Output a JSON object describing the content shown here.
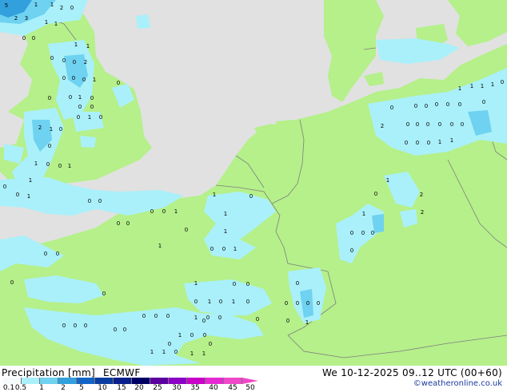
{
  "map": {
    "colors": {
      "sea": "#e1e1e1",
      "land": "#b5f08a",
      "border": "#7f7f7f",
      "precip_light": "#aaf0fa",
      "precip_medium": "#6ed2f0",
      "precip_heavy": "#32a0dc"
    },
    "values": [
      {
        "t": "5"
      },
      {
        "t": "2"
      },
      {
        "t": "3"
      },
      {
        "t": "1"
      },
      {
        "t": "1"
      },
      {
        "t": "1"
      },
      {
        "t": "2"
      },
      {
        "t": "0"
      },
      {
        "t": "0"
      },
      {
        "t": "1"
      },
      {
        "t": "0"
      },
      {
        "t": "0"
      },
      {
        "t": "0"
      },
      {
        "t": "1"
      },
      {
        "t": "2"
      },
      {
        "t": "0"
      },
      {
        "t": "1"
      },
      {
        "t": "0"
      },
      {
        "t": "0"
      },
      {
        "t": "1"
      },
      {
        "t": "0"
      },
      {
        "t": "0"
      },
      {
        "t": "0"
      },
      {
        "t": "0"
      },
      {
        "t": "2"
      },
      {
        "t": "1"
      },
      {
        "t": "0"
      },
      {
        "t": "0"
      },
      {
        "t": "1"
      },
      {
        "t": "0"
      },
      {
        "t": "0"
      },
      {
        "t": "0"
      },
      {
        "t": "1"
      },
      {
        "t": "0"
      },
      {
        "t": "0"
      },
      {
        "t": "1"
      },
      {
        "t": "0"
      },
      {
        "t": "0"
      },
      {
        "t": "1"
      },
      {
        "t": "1"
      },
      {
        "t": "0"
      },
      {
        "t": "0"
      },
      {
        "t": "1"
      },
      {
        "t": "0"
      },
      {
        "t": "0"
      },
      {
        "t": "0"
      },
      {
        "t": "0"
      },
      {
        "t": "0"
      },
      {
        "t": "0"
      },
      {
        "t": "0"
      },
      {
        "t": "0"
      },
      {
        "t": "0"
      },
      {
        "t": "0"
      },
      {
        "t": "1"
      },
      {
        "t": "0"
      },
      {
        "t": "1"
      },
      {
        "t": "1"
      },
      {
        "t": "0"
      },
      {
        "t": "1"
      },
      {
        "t": "1"
      },
      {
        "t": "0"
      },
      {
        "t": "0"
      },
      {
        "t": "1"
      },
      {
        "t": "1"
      },
      {
        "t": "0"
      },
      {
        "t": "0"
      },
      {
        "t": "0"
      },
      {
        "t": "1"
      },
      {
        "t": "0"
      },
      {
        "t": "1"
      },
      {
        "t": "0"
      },
      {
        "t": "0"
      },
      {
        "t": "0"
      },
      {
        "t": "0"
      },
      {
        "t": "1"
      },
      {
        "t": "0"
      },
      {
        "t": "0"
      },
      {
        "t": "0"
      },
      {
        "t": "0"
      },
      {
        "t": "0"
      },
      {
        "t": "0"
      },
      {
        "t": "0"
      },
      {
        "t": "0"
      },
      {
        "t": "1"
      },
      {
        "t": "0"
      },
      {
        "t": "0"
      },
      {
        "t": "0"
      },
      {
        "t": "0"
      },
      {
        "t": "0"
      },
      {
        "t": "0"
      },
      {
        "t": "0"
      },
      {
        "t": "0"
      },
      {
        "t": "0"
      },
      {
        "t": "0"
      },
      {
        "t": "1"
      },
      {
        "t": "0"
      },
      {
        "t": "0"
      },
      {
        "t": "0"
      },
      {
        "t": "0"
      },
      {
        "t": "1"
      },
      {
        "t": "0"
      },
      {
        "t": "1"
      },
      {
        "t": "1"
      },
      {
        "t": "0"
      },
      {
        "t": "1"
      },
      {
        "t": "1"
      },
      {
        "t": "0"
      },
      {
        "t": "1"
      },
      {
        "t": "2"
      },
      {
        "t": "2"
      },
      {
        "t": "2"
      },
      {
        "t": "0"
      },
      {
        "t": "0"
      },
      {
        "t": "0"
      },
      {
        "t": "0"
      },
      {
        "t": "0"
      },
      {
        "t": "0"
      },
      {
        "t": "0"
      },
      {
        "t": "0"
      },
      {
        "t": "0"
      },
      {
        "t": "0"
      },
      {
        "t": "0"
      },
      {
        "t": "0"
      },
      {
        "t": "0"
      },
      {
        "t": "0"
      },
      {
        "t": "0"
      },
      {
        "t": "1"
      },
      {
        "t": "1"
      },
      {
        "t": "1"
      },
      {
        "t": "1"
      },
      {
        "t": "1"
      },
      {
        "t": "1"
      },
      {
        "t": "0"
      },
      {
        "t": "0"
      }
    ]
  },
  "footer": {
    "title": "Precipitation [mm]",
    "model": "ECMWF",
    "datetime": "We 10-12-2025 09..12 UTC (00+60)",
    "copyright": "©weatheronline.co.uk",
    "scale": {
      "labels": [
        "0.1",
        "0.5",
        "1",
        "2",
        "5",
        "10",
        "15",
        "20",
        "25",
        "30",
        "35",
        "40",
        "45",
        "50"
      ],
      "colors": [
        "#f5fafa",
        "#aaf0fa",
        "#6ed2f0",
        "#32a0dc",
        "#1464c8",
        "#0a3ca0",
        "#0a1e8c",
        "#000064",
        "#5a00a0",
        "#8c00c8",
        "#c800c8",
        "#e628d2",
        "#f048c8"
      ]
    }
  }
}
